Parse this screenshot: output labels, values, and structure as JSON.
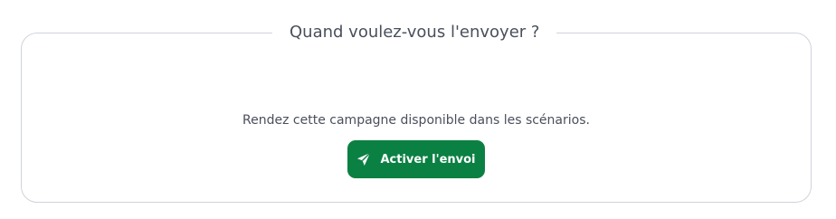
{
  "section": {
    "title": "Quand voulez-vous l'envoyer ?",
    "description": "Rendez cette campagne disponible dans les scénarios."
  },
  "action_button": {
    "label": "Activer l'envoi",
    "icon": "paper-plane-icon",
    "color": "#0b8043"
  }
}
